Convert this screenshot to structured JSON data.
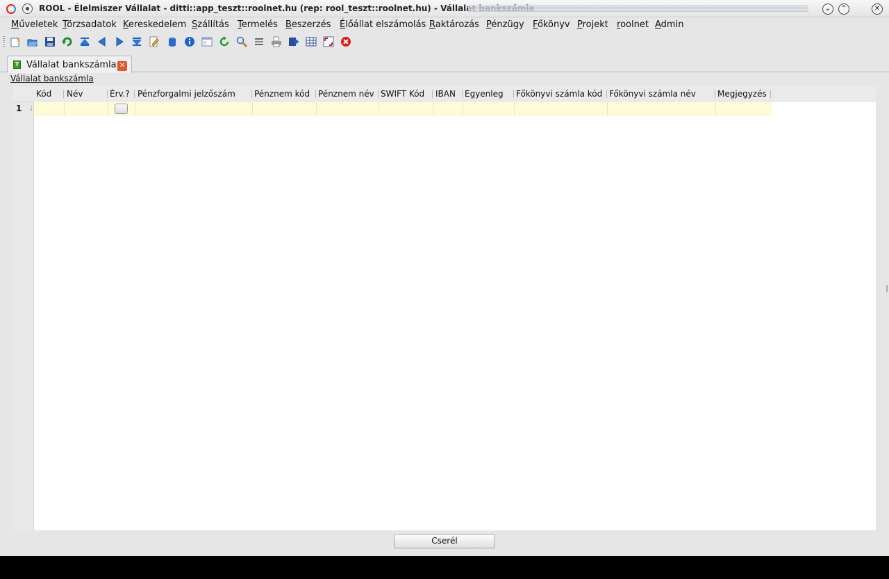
{
  "titlebar": {
    "title": "ROOL - Élelmiszer Vállalat - ditti::app_teszt::roolnet.hu (rep: rool_teszt::roolnet.hu) - Vállalat bankszámla",
    "minimize_glyph": "⌄",
    "maximize_glyph": "⌃",
    "close_glyph": "✕"
  },
  "menu": [
    "Műveletek",
    "Törzsadatok",
    "Kereskedelem",
    "Szállítás",
    "Termelés",
    "Beszerzés",
    "Élőállat elszámolás",
    "Raktározás",
    "Pénzügy",
    "Főkönyv",
    "Projekt",
    "roolnet",
    "Admin"
  ],
  "toolbar": {
    "icons": [
      "new-icon",
      "open-icon",
      "save-icon",
      "undo-icon",
      "first-record-icon",
      "previous-record-icon",
      "next-record-icon",
      "last-record-icon",
      "edit-icon",
      "database-icon",
      "info-icon",
      "form-view-icon",
      "refresh-icon",
      "search-icon",
      "list-view-icon",
      "print-icon",
      "export-icon",
      "grid-view-icon",
      "fullscreen-icon",
      "close-red-icon"
    ]
  },
  "tab": {
    "icon_letter": "T",
    "label": "Vállalat bankszámla",
    "close_glyph": "✕"
  },
  "form": {
    "title": "Vállalat bankszámla"
  },
  "grid": {
    "columns": [
      "Kód",
      "Név",
      "Érv.?",
      "Pénzforgalmi jelzőszám",
      "Pénznem kód",
      "Pénznem név",
      "SWIFT Kód",
      "IBAN",
      "Egyenleg",
      "Főkönyvi számla kód",
      "Főkönyvi számla név",
      "Megjegyzés"
    ],
    "rows": [
      {
        "number": "1"
      }
    ]
  },
  "actions": {
    "replace_label": "Cserél"
  },
  "colors": {
    "row_highlight": "#fffbd6",
    "close_tab": "#e8552a",
    "title_accent_red": "#dd2222"
  }
}
